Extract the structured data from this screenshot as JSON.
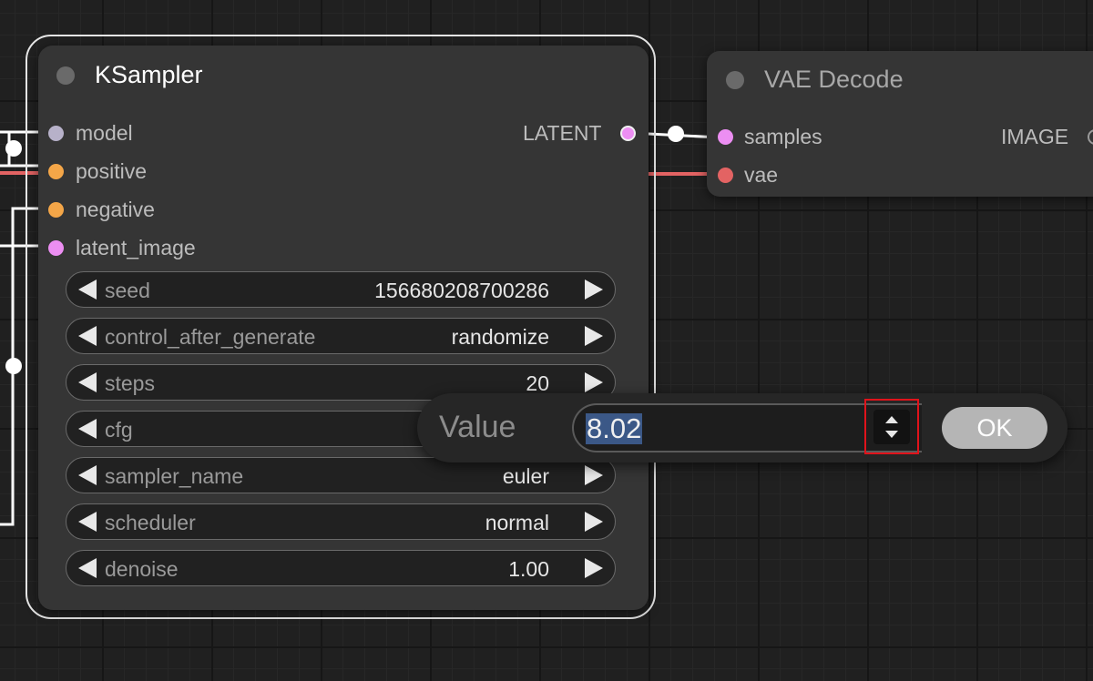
{
  "ksampler": {
    "title": "KSampler",
    "inputs": [
      {
        "label": "model",
        "color": "#b7b1c9"
      },
      {
        "label": "positive",
        "color": "#f4a648"
      },
      {
        "label": "negative",
        "color": "#f4a648"
      },
      {
        "label": "latent_image",
        "color": "#ec8ef2"
      }
    ],
    "output": {
      "label": "LATENT",
      "color": "#ec8ef2"
    },
    "widgets": [
      {
        "name": "seed",
        "value": "156680208700286"
      },
      {
        "name": "control_after_generate",
        "value": "randomize"
      },
      {
        "name": "steps",
        "value": "20"
      },
      {
        "name": "cfg",
        "value": ""
      },
      {
        "name": "sampler_name",
        "value": "euler"
      },
      {
        "name": "scheduler",
        "value": "normal"
      },
      {
        "name": "denoise",
        "value": "1.00"
      }
    ]
  },
  "vae_decode": {
    "title": "VAE Decode",
    "inputs": [
      {
        "label": "samples",
        "color": "#ec8ef2"
      },
      {
        "label": "vae",
        "color": "#e36363"
      }
    ],
    "output": {
      "label": "IMAGE",
      "color": "#9a9a9a"
    }
  },
  "prompt": {
    "label": "Value",
    "value": "8.02",
    "ok_label": "OK"
  },
  "colors": {
    "background": "#202020",
    "node": "#353535",
    "vae_link": "#e36363",
    "highlight_box": "#e0131b",
    "text_selection": "#3b5887"
  },
  "icons": [
    "arrow-left-icon",
    "arrow-right-icon",
    "spinner-up-icon",
    "spinner-down-icon"
  ]
}
